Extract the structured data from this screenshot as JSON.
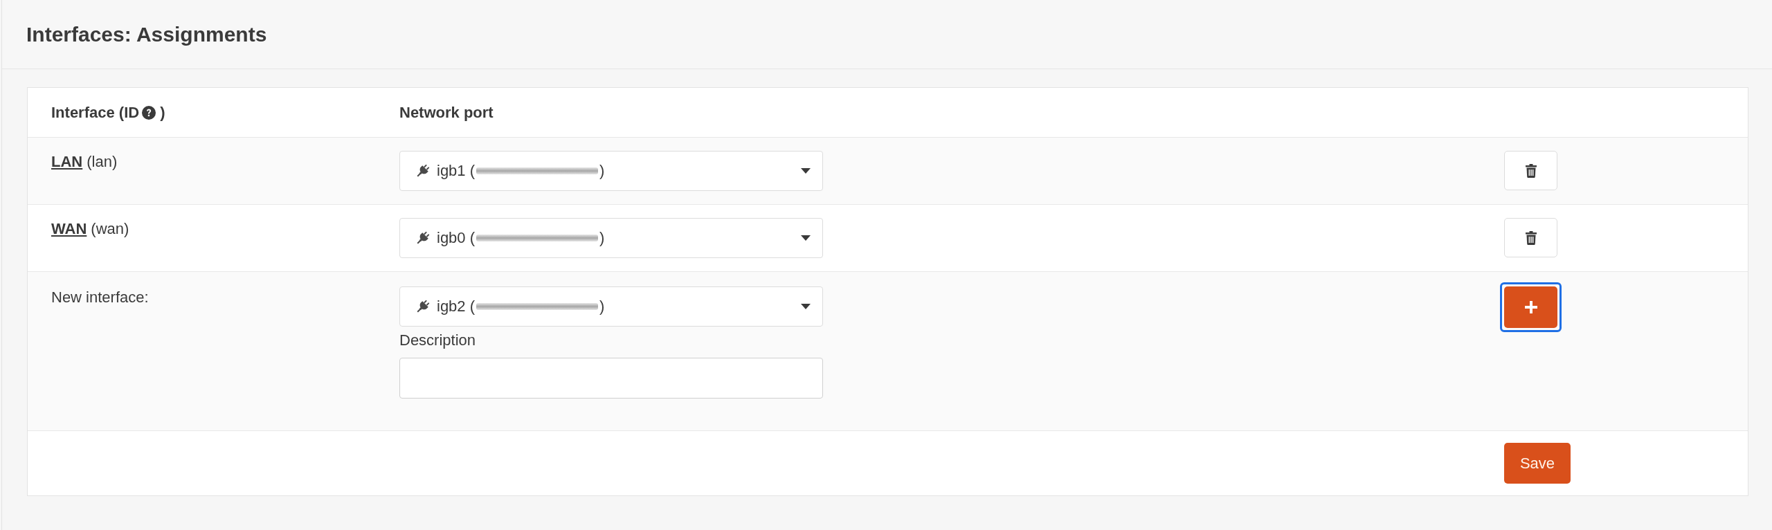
{
  "page": {
    "title": "Interfaces: Assignments"
  },
  "table": {
    "columns": [
      {
        "label": "Interface (ID",
        "help_icon": true,
        "label_after_icon": ")"
      },
      {
        "label": "Network port"
      }
    ],
    "rows": [
      {
        "kind": "assigned",
        "name": "LAN",
        "id": "(lan)",
        "port": {
          "text_before_redaction": "igb1 (",
          "redacted": true,
          "text_after_redaction": ")"
        },
        "button": {
          "kind": "delete",
          "focused": false
        }
      },
      {
        "kind": "assigned",
        "name": "WAN",
        "id": "(wan)",
        "port": {
          "text_before_redaction": "igb0 (",
          "redacted": true,
          "text_after_redaction": ")"
        },
        "button": {
          "kind": "delete",
          "focused": false
        }
      },
      {
        "kind": "new",
        "label": "New interface:",
        "port": {
          "text_before_redaction": "igb2 (",
          "redacted": true,
          "text_after_redaction": ")"
        },
        "description": {
          "label": "Description"
        },
        "button": {
          "kind": "add",
          "focused": true
        }
      }
    ]
  },
  "footer": {
    "save_button": "Save"
  }
}
